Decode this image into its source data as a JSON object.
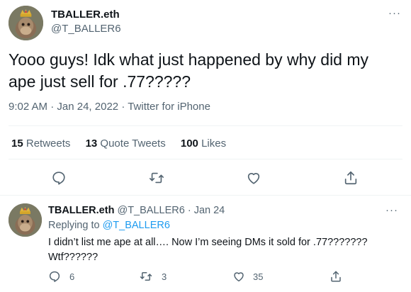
{
  "main_tweet": {
    "author_name": "TBALLER.eth",
    "author_handle": "@T_BALLER6",
    "more": "···",
    "text": "Yooo guys! Idk what just happened by why did my ape just sell for .77?????",
    "time": "9:02 AM",
    "date": "Jan 24, 2022",
    "source": "Twitter for iPhone",
    "stats": {
      "retweets_count": "15",
      "retweets_label": "Retweets",
      "quote_count": "13",
      "quote_label": "Quote Tweets",
      "likes_count": "100",
      "likes_label": "Likes"
    },
    "actions": [
      "reply-icon",
      "retweet-icon",
      "like-icon",
      "share-icon"
    ]
  },
  "reply_tweet": {
    "author_name": "TBALLER.eth",
    "author_handle": "@T_BALLER6",
    "date": "Jan 24",
    "more": "···",
    "replying_to_label": "Replying to",
    "replying_to_handle": "@T_BALLER6",
    "text_line1": "I didn’t list me ape at all…. Now I’m seeing DMs it sold for .77???????",
    "text_line2": "Wtf??????",
    "reply_count": "6",
    "retweet_count": "3",
    "like_count": "35"
  },
  "colors": {
    "link": "#1d9bf0",
    "muted": "#536471",
    "text": "#0f1419",
    "divider": "#eff3f4"
  }
}
